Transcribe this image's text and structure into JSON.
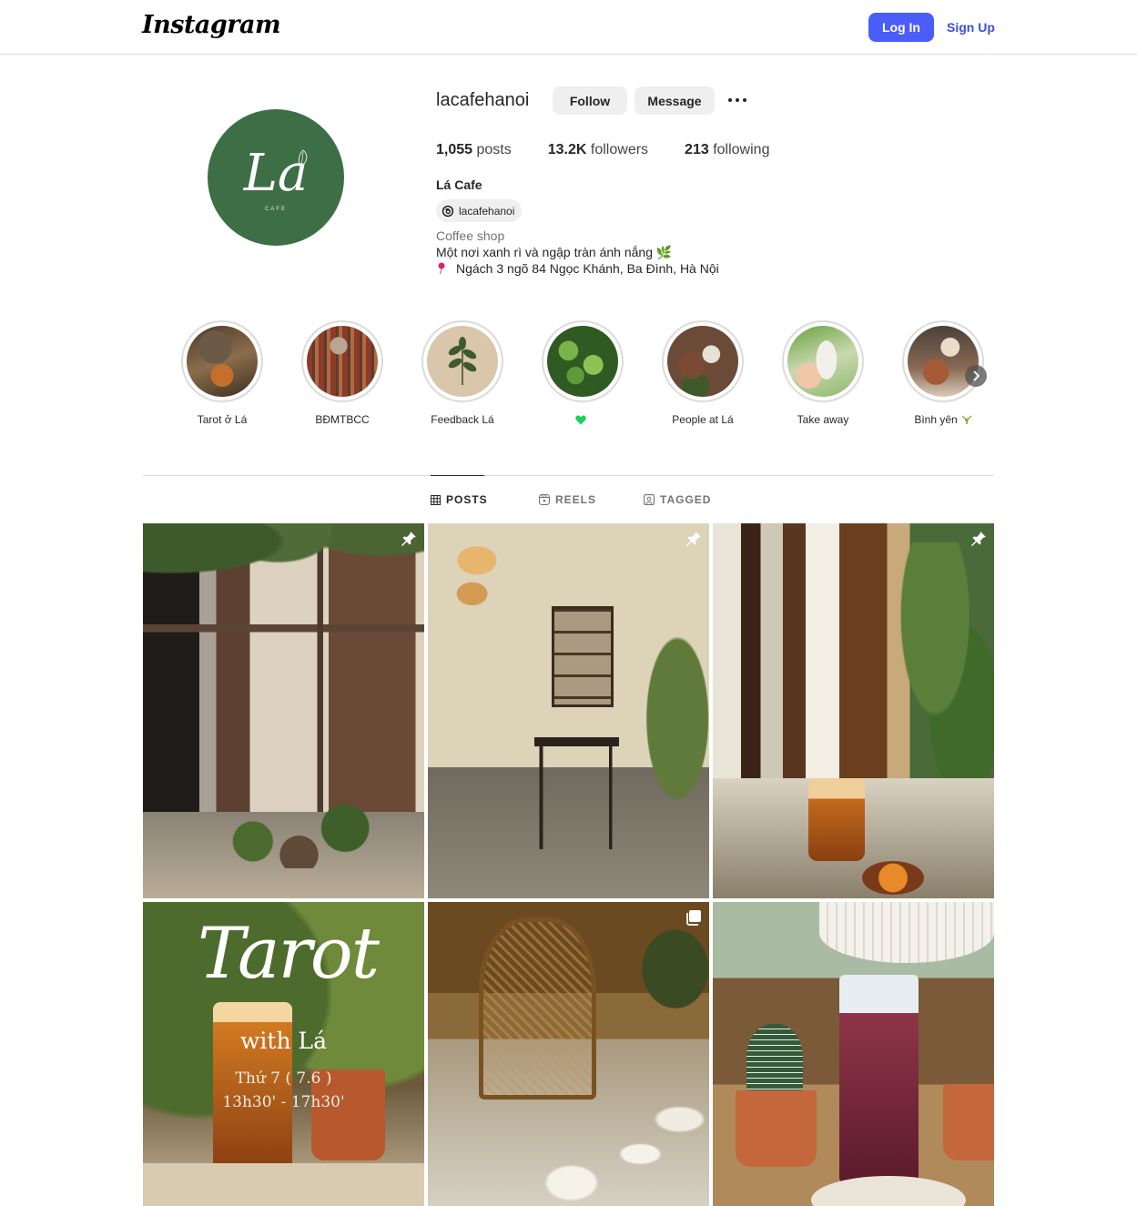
{
  "topbar": {
    "logo_text": "Instagram",
    "login_label": "Log In",
    "signup_label": "Sign Up",
    "accent_color": "#4a5df9"
  },
  "profile": {
    "username": "lacafehanoi",
    "follow_label": "Follow",
    "message_label": "Message",
    "avatar_logo": "La",
    "avatar_sub": "CAFE",
    "stats": {
      "posts_count": "1,055",
      "posts_label": "posts",
      "followers_count": "13.2K",
      "followers_label": "followers",
      "following_count": "213",
      "following_label": "following"
    },
    "full_name": "Lá Cafe",
    "threads_handle": "lacafehanoi",
    "category": "Coffee shop",
    "bio_line1": "Một nơi xanh rì và ngập tràn ánh nắng 🌿",
    "bio_line2": "Ngách 3 ngõ 84 Ngọc Khánh, Ba Đình, Hà Nội"
  },
  "highlights": [
    {
      "label": "Tarot ở Lá",
      "icon": "tarot-thumb"
    },
    {
      "label": "BĐMTBCC",
      "icon": "cat-thumb"
    },
    {
      "label": "Feedback Lá",
      "icon": "leaf-thumb"
    },
    {
      "label": "",
      "icon": "green-heart"
    },
    {
      "label": "People at Lá",
      "icon": "people-thumb"
    },
    {
      "label": "Take away",
      "icon": "bottle-thumb"
    },
    {
      "label": "Bình yên",
      "icon": "drink-thumb"
    }
  ],
  "tabs": [
    {
      "label": "POSTS",
      "icon": "grid-icon",
      "active": true
    },
    {
      "label": "REELS",
      "icon": "reels-icon",
      "active": false
    },
    {
      "label": "TAGGED",
      "icon": "tagged-icon",
      "active": false
    }
  ],
  "posts": [
    {
      "name": "cafe-facade",
      "pinned": true
    },
    {
      "name": "interior-table",
      "pinned": true
    },
    {
      "name": "tea-by-window",
      "pinned": true
    },
    {
      "name": "tarot-event",
      "pinned": false,
      "overlay_title": "Tarot",
      "overlay_sub": "with Lá",
      "overlay_date": "Thứ 7 ( 7.6 )",
      "overlay_time": "13h30' - 17h30'"
    },
    {
      "name": "rattan-chair",
      "pinned": false,
      "carousel": true
    },
    {
      "name": "iced-drink-cactus",
      "pinned": false
    }
  ]
}
